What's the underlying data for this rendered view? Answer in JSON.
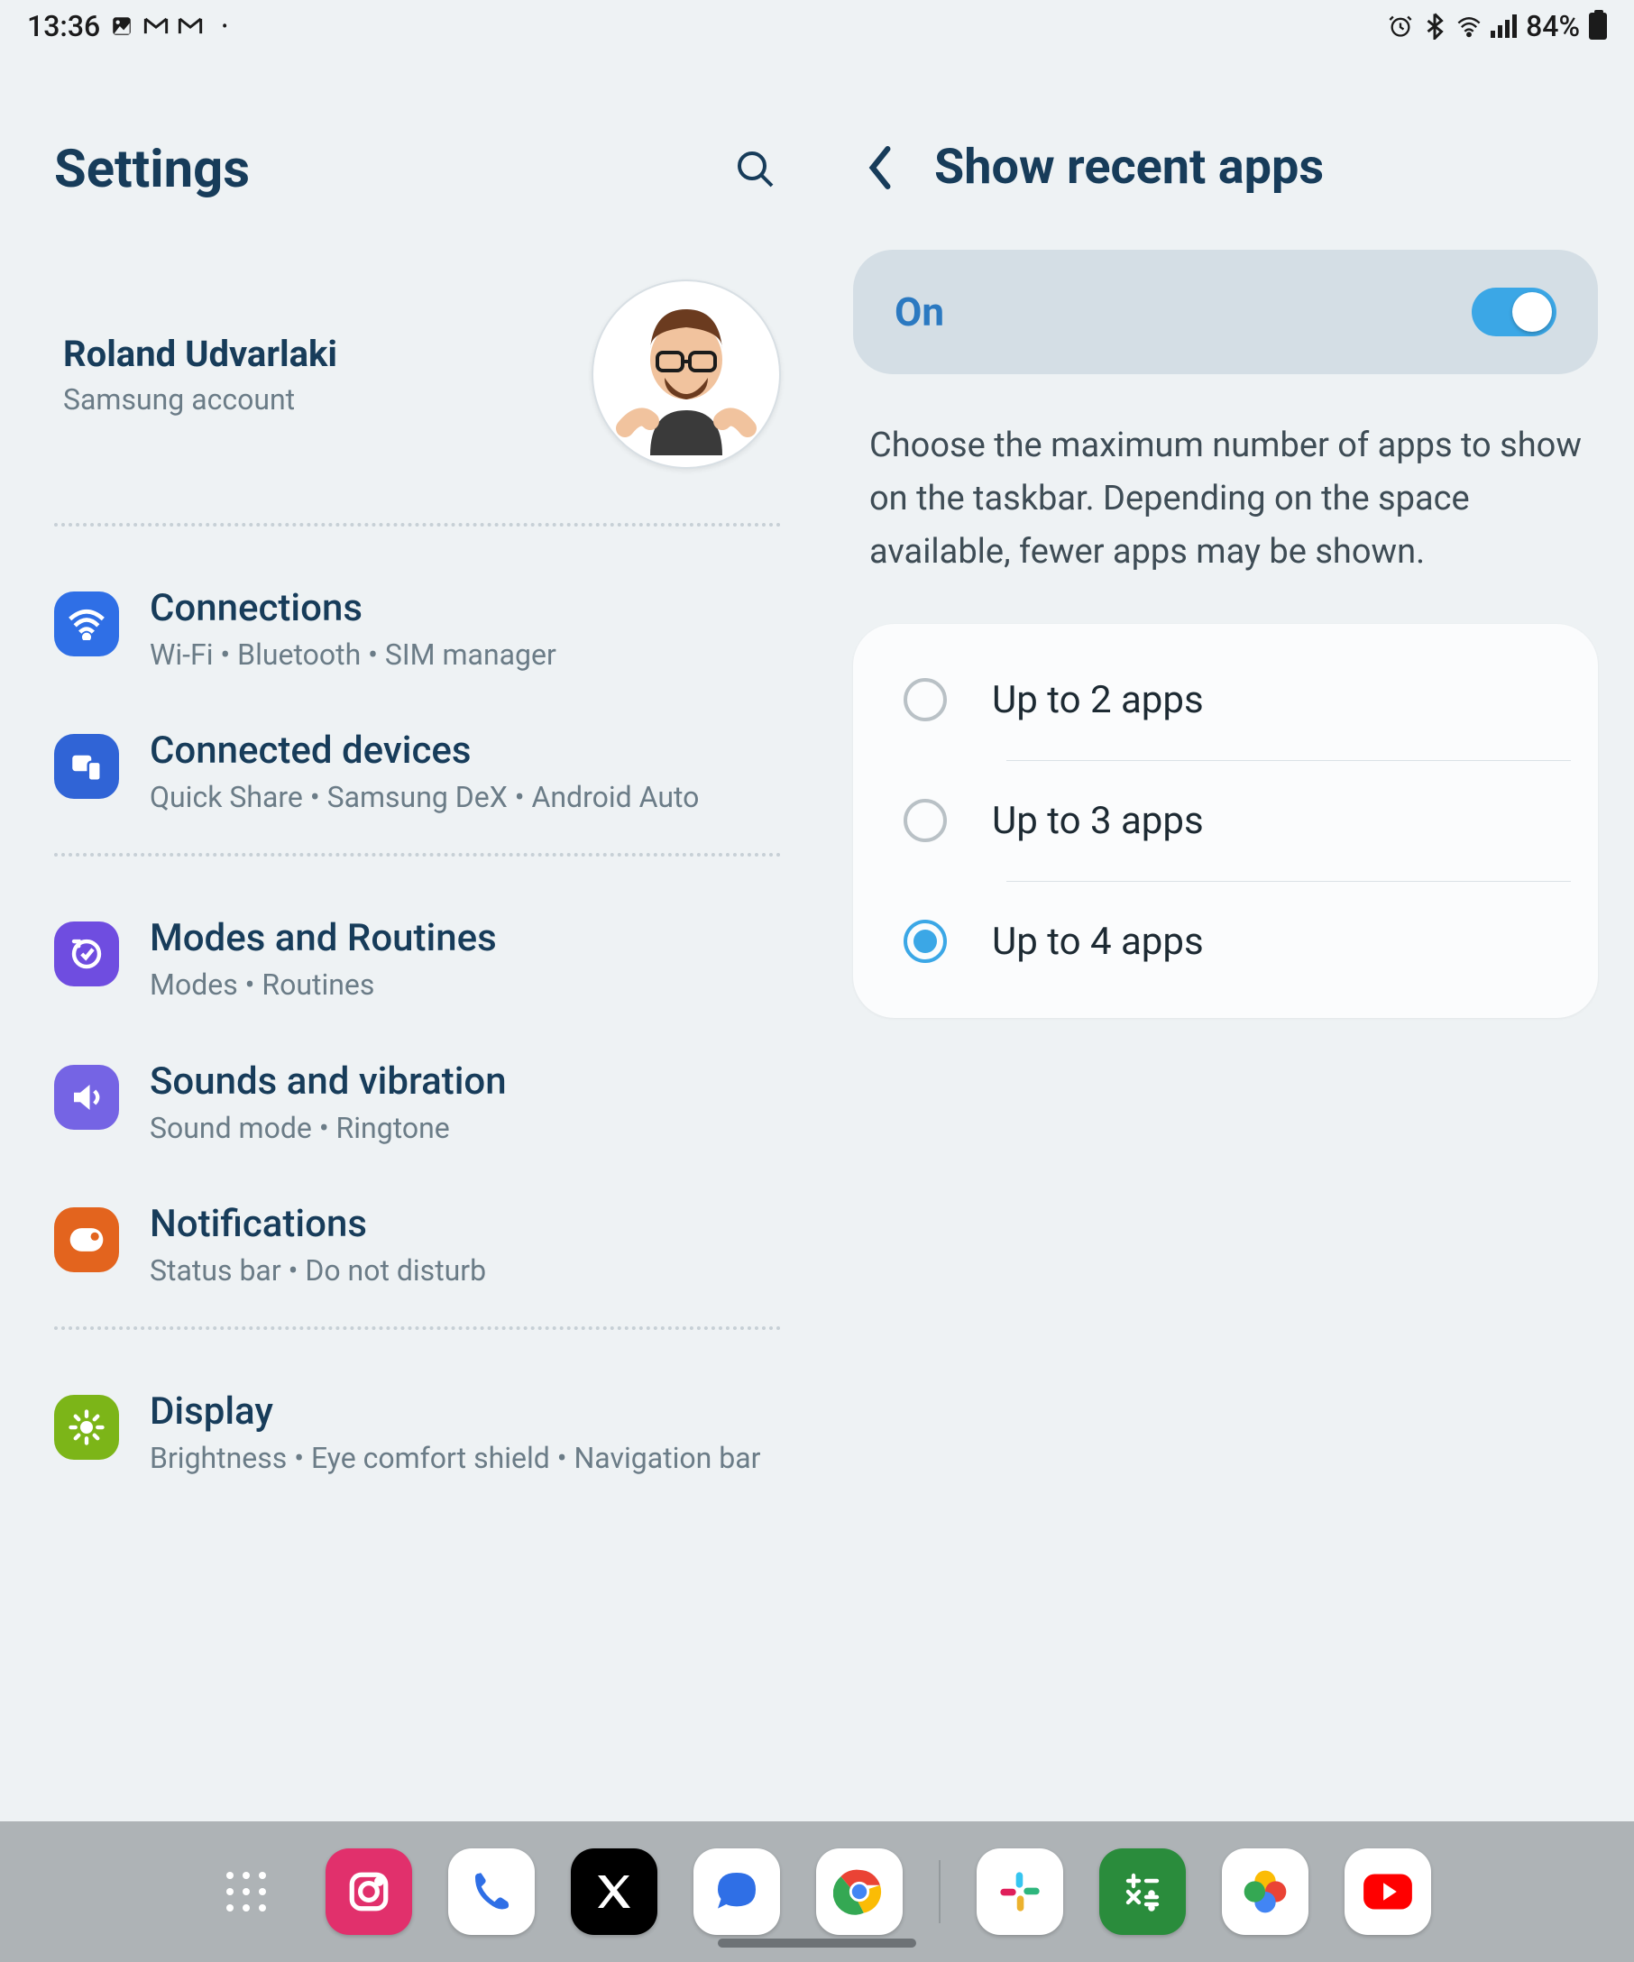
{
  "status": {
    "time": "13:36",
    "battery_text": "84%"
  },
  "left": {
    "title": "Settings",
    "account": {
      "name": "Roland Udvarlaki",
      "sub": "Samsung account"
    },
    "items": [
      {
        "title": "Connections",
        "sub": "Wi-Fi  •  Bluetooth  •  SIM manager"
      },
      {
        "title": "Connected devices",
        "sub": "Quick Share  •  Samsung DeX  •  Android Auto"
      },
      {
        "title": "Modes and Routines",
        "sub": "Modes  •  Routines"
      },
      {
        "title": "Sounds and vibration",
        "sub": "Sound mode  •  Ringtone"
      },
      {
        "title": "Notifications",
        "sub": "Status bar  •  Do not disturb"
      },
      {
        "title": "Display",
        "sub": "Brightness  •  Eye comfort shield  •  Navigation bar"
      }
    ]
  },
  "right": {
    "title": "Show recent apps",
    "toggle_label": "On",
    "toggle_on": true,
    "description": "Choose the maximum number of apps to show on the taskbar. Depending on the space available, fewer apps may be shown.",
    "options": [
      {
        "label": "Up to 2 apps",
        "selected": false
      },
      {
        "label": "Up to 3 apps",
        "selected": false
      },
      {
        "label": "Up to 4 apps",
        "selected": true
      }
    ]
  },
  "taskbar": {
    "apps": [
      "apps-drawer",
      "instagram",
      "phone",
      "x",
      "messages",
      "chrome",
      "|",
      "slack",
      "calculator",
      "photos",
      "youtube"
    ]
  }
}
